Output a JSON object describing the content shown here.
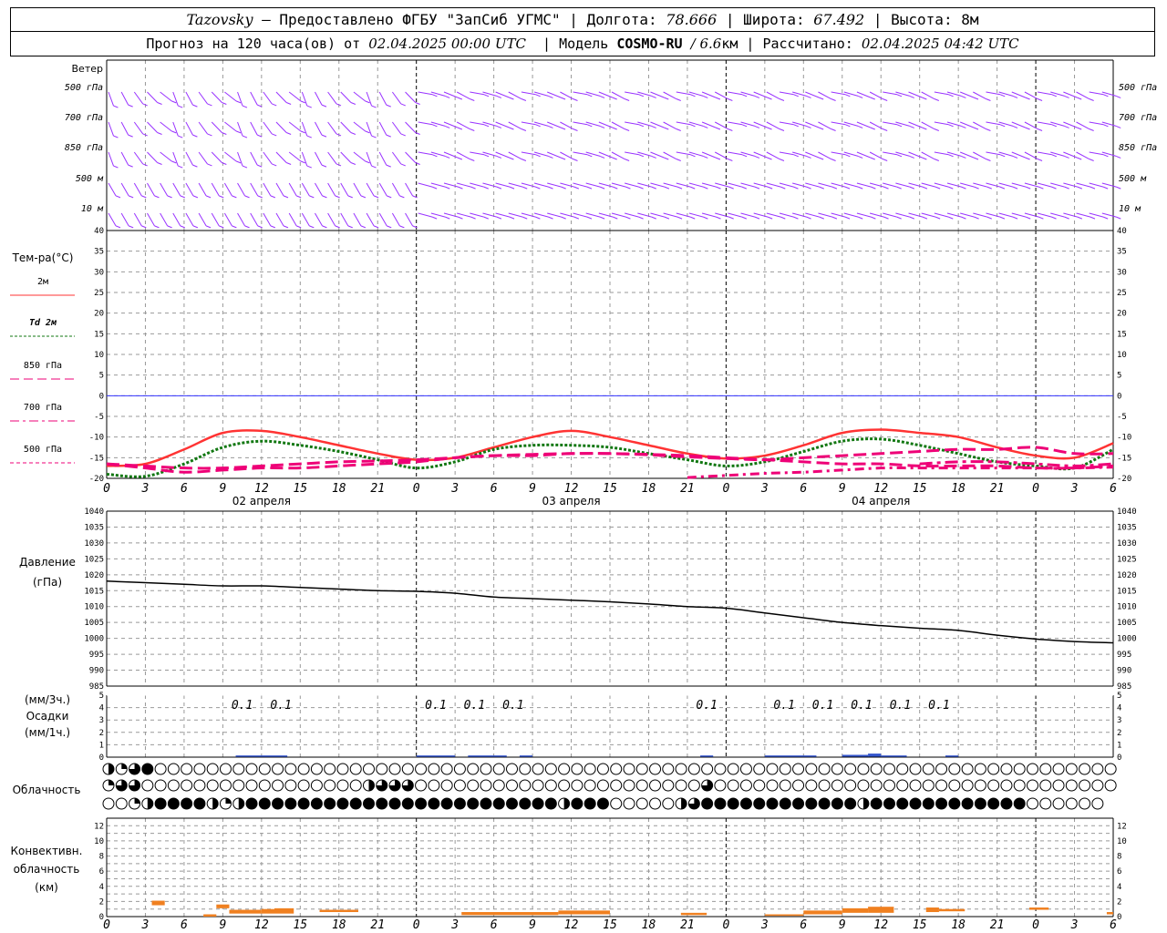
{
  "header": {
    "station": "Tazovsky",
    "provided_by": "— Предоставлено ФГБУ \"ЗапСиб УГМС\"",
    "lon_label": "Долгота:",
    "lon_value": "78.666",
    "lat_label": "Широта:",
    "lat_value": "67.492",
    "alt_label": "Высота:",
    "alt_value": "8м",
    "forecast_label": "Прогноз на 120 часа(ов) от",
    "forecast_start": "02.04.2025 00:00 UTC",
    "model_label": "Модель",
    "model_name": "COSMO-RU",
    "model_res": "/ 6.6",
    "model_res_unit": "км",
    "calc_label": "Рассчитано:",
    "calc_time": "02.04.2025 04:42 UTC"
  },
  "colors": {
    "wind": "#9933ff",
    "t2m": "#ff3333",
    "td2m": "#117711",
    "t850": "#ee0077",
    "t700": "#ee0077",
    "t500": "#ee0077",
    "zero_line": "#3333ff",
    "pressure": "#000000",
    "precip": "#3355cc",
    "convective": "#f08020",
    "grid": "#999999"
  },
  "chart_data": [
    {
      "type": "wind_barbs",
      "panel_title": "Ветер",
      "levels": [
        "500 гПа",
        "700 гПа",
        "850 гПа",
        "500 м",
        "10 м"
      ]
    },
    {
      "type": "line",
      "panel_title": "Тем-ра(°C)",
      "x_tick_labels": [
        "0",
        "3",
        "6",
        "9",
        "12",
        "15",
        "18",
        "21",
        "0",
        "3",
        "6",
        "9",
        "12",
        "15",
        "18",
        "21",
        "0",
        "3",
        "6",
        "9",
        "12",
        "15",
        "18",
        "21",
        "0",
        "3",
        "6"
      ],
      "day_labels": [
        "02 апреля",
        "03 апреля",
        "04 апреля"
      ],
      "x_hours_range": [
        0,
        78
      ],
      "ylim": [
        -20,
        40
      ],
      "y_ticks": [
        -20,
        -15,
        -10,
        -5,
        0,
        5,
        10,
        15,
        20,
        25,
        30,
        35,
        40
      ],
      "legend": [
        {
          "id": "t2m",
          "label": "2м"
        },
        {
          "id": "td2m",
          "label_prefix": "Td",
          "label": "2м"
        },
        {
          "id": "t850",
          "label": "850 гПа"
        },
        {
          "id": "t700",
          "label": "700 гПа"
        },
        {
          "id": "t500",
          "label": "500 гПа"
        }
      ],
      "series": [
        {
          "name": "2м",
          "x": [
            0,
            3,
            6,
            9,
            12,
            15,
            18,
            21,
            24,
            27,
            30,
            33,
            36,
            39,
            42,
            45,
            48,
            51,
            54,
            57,
            60,
            63,
            66,
            69,
            72,
            75,
            78
          ],
          "values": [
            -17,
            -16.5,
            -13,
            -9,
            -8.5,
            -10,
            -12,
            -14,
            -15.5,
            -15,
            -12.5,
            -10,
            -8.5,
            -10,
            -12,
            -14,
            -15.2,
            -14.5,
            -12,
            -9,
            -8.2,
            -9,
            -10,
            -12.5,
            -14.5,
            -15,
            -11.5
          ]
        },
        {
          "name": "Td 2м",
          "x": [
            0,
            3,
            6,
            9,
            12,
            15,
            18,
            21,
            24,
            27,
            30,
            33,
            36,
            39,
            42,
            45,
            48,
            51,
            54,
            57,
            60,
            63,
            66,
            69,
            72,
            75,
            78
          ],
          "values": [
            -19,
            -19.5,
            -16.5,
            -12.5,
            -11,
            -12,
            -13.5,
            -15.5,
            -17.5,
            -16,
            -13,
            -12,
            -12,
            -12.5,
            -14,
            -15.5,
            -17,
            -16,
            -13.5,
            -11,
            -10.5,
            -12,
            -14,
            -16,
            -17,
            -17.5,
            -13
          ]
        },
        {
          "name": "850 гПа",
          "x": [
            0,
            3,
            6,
            9,
            12,
            15,
            18,
            21,
            24,
            27,
            30,
            33,
            36,
            39,
            42,
            45,
            48,
            51,
            54,
            57,
            60,
            63,
            66,
            69,
            72,
            75,
            78
          ],
          "values": [
            -16.5,
            -17,
            -17.5,
            -17.5,
            -17,
            -16.5,
            -16,
            -15.8,
            -15.5,
            -15,
            -14.5,
            -14.2,
            -14,
            -14,
            -14.3,
            -14.8,
            -15.2,
            -15.5,
            -15,
            -14.5,
            -14,
            -13.5,
            -13,
            -13,
            -12.5,
            -14,
            -14
          ]
        },
        {
          "name": "700 гПа",
          "x": [
            63,
            66,
            69,
            72,
            75,
            78
          ],
          "values": [
            -16.5,
            -16,
            -16,
            -16.5,
            -17,
            -16.5
          ]
        },
        {
          "name": "500 гПа",
          "x": [
            0,
            3,
            6,
            9,
            12,
            15,
            18,
            21,
            24,
            27,
            30,
            33,
            36,
            39,
            42,
            45,
            48,
            51,
            54,
            57,
            60,
            63,
            66,
            69,
            72,
            75,
            78
          ],
          "values": [
            -16.5,
            -17.5,
            -18.5,
            -18,
            -17.5,
            -17.5,
            -17,
            -16.5,
            -16,
            -15,
            -14.5,
            -14.5,
            -14,
            -14,
            -14.2,
            -14.5,
            -15,
            -15.5,
            -16,
            -16.5,
            -16.5,
            -17,
            -17,
            -17,
            -17.5,
            -17.5,
            -17
          ]
        },
        {
          "name": "500 гПа dash-dot",
          "x": [
            45,
            48,
            51,
            54,
            57,
            60,
            63,
            66,
            69,
            72,
            75,
            78
          ],
          "values": [
            -19.8,
            -19.3,
            -18.8,
            -18.5,
            -18,
            -17.5,
            -17.5,
            -17.5,
            -17.5,
            -17.5,
            -17.5,
            -17.3
          ]
        }
      ]
    },
    {
      "type": "line",
      "panel_title": "Давление",
      "panel_unit": "(гПа)",
      "ylim": [
        985,
        1040
      ],
      "y_ticks": [
        985,
        990,
        995,
        1000,
        1005,
        1010,
        1015,
        1020,
        1025,
        1030,
        1035,
        1040
      ],
      "series": [
        {
          "name": "Давление",
          "x": [
            0,
            3,
            6,
            9,
            12,
            15,
            18,
            21,
            24,
            27,
            30,
            33,
            36,
            39,
            42,
            45,
            48,
            51,
            54,
            57,
            60,
            63,
            66,
            69,
            72,
            75,
            78
          ],
          "values": [
            1018,
            1017.5,
            1017,
            1016.5,
            1016.5,
            1016,
            1015.5,
            1015,
            1014.8,
            1014.2,
            1013,
            1012.5,
            1012,
            1011.5,
            1010.8,
            1010,
            1009.5,
            1008,
            1006.5,
            1005,
            1004,
            1003.2,
            1002.5,
            1001,
            999.8,
            999,
            998.6
          ]
        }
      ]
    },
    {
      "type": "bar",
      "panel_title": "Осадки",
      "units_3h": "(мм/3ч.)",
      "units_1h": "(мм/1ч.)",
      "ylim": [
        0,
        5
      ],
      "y_ticks": [
        0,
        1,
        2,
        3,
        4,
        5
      ],
      "labels": [
        {
          "x": 10.5,
          "text": "0.1"
        },
        {
          "x": 13.5,
          "text": "0.1"
        },
        {
          "x": 25.5,
          "text": "0.1"
        },
        {
          "x": 28.5,
          "text": "0.1"
        },
        {
          "x": 31.5,
          "text": "0.1"
        },
        {
          "x": 46.5,
          "text": "0.1"
        },
        {
          "x": 52.5,
          "text": "0.1"
        },
        {
          "x": 55.5,
          "text": "0.1"
        },
        {
          "x": 58.5,
          "text": "0.1"
        },
        {
          "x": 61.5,
          "text": "0.1"
        },
        {
          "x": 64.5,
          "text": "0.1"
        }
      ],
      "hourly_values": [
        {
          "x0": 10,
          "x1": 14,
          "value": 0.1
        },
        {
          "x0": 24,
          "x1": 27,
          "value": 0.1
        },
        {
          "x0": 28,
          "x1": 31,
          "value": 0.1
        },
        {
          "x0": 32,
          "x1": 33,
          "value": 0.1
        },
        {
          "x0": 46,
          "x1": 47,
          "value": 0.1
        },
        {
          "x0": 51,
          "x1": 55,
          "value": 0.1
        },
        {
          "x0": 57,
          "x1": 59,
          "value": 0.15
        },
        {
          "x0": 59,
          "x1": 60,
          "value": 0.25
        },
        {
          "x0": 60,
          "x1": 62,
          "value": 0.1
        },
        {
          "x0": 65,
          "x1": 66,
          "value": 0.1
        }
      ]
    },
    {
      "type": "cloud_cover",
      "panel_title": "Облачность",
      "rows": [
        "HQTFOOOOOOOOOOOOOOOOOOOOOOOOOOOOOOOOOOOOOOOOOOOOOOOOOOOOOOOOOOOOOOOOOOOOOOOOOO",
        "QTTOOOOOOOOOOOOOOOOOHTTTOOOOOOOOOOOOOOOOOOOOOOTOOOOOOOOOOOOOOOOOOOOOOOOOOOOOOOOO",
        "OOQHFFFFHQHFFFFFFFFFFFFFFFFFFFFFFFFHFFFOOOOOHTFFFFFFFFFFFFHFFFFFFFFFFFFOOOOOO"
      ]
    },
    {
      "type": "bar",
      "panel_title": "Конвективн. облачность (км)",
      "ylim": [
        0,
        13
      ],
      "y_ticks": [
        0,
        2,
        4,
        6,
        8,
        10,
        12
      ],
      "bars": [
        {
          "x0": 3.5,
          "x1": 4.5,
          "base": 1.5,
          "top": 2.1
        },
        {
          "x0": 7.5,
          "x1": 8.5,
          "base": 0,
          "top": 0.3
        },
        {
          "x0": 8.5,
          "x1": 9.5,
          "base": 1.1,
          "top": 1.6
        },
        {
          "x0": 9.5,
          "x1": 12,
          "base": 0.4,
          "top": 0.9
        },
        {
          "x0": 12,
          "x1": 13,
          "base": 0.4,
          "top": 1.0
        },
        {
          "x0": 13,
          "x1": 14.5,
          "base": 0.4,
          "top": 1.1
        },
        {
          "x0": 16.5,
          "x1": 19.5,
          "base": 0.6,
          "top": 0.9
        },
        {
          "x0": 27.5,
          "x1": 35,
          "base": 0.2,
          "top": 0.6
        },
        {
          "x0": 35,
          "x1": 39,
          "base": 0.3,
          "top": 0.8
        },
        {
          "x0": 44.5,
          "x1": 46.5,
          "base": 0.2,
          "top": 0.5
        },
        {
          "x0": 51,
          "x1": 54,
          "base": 0.1,
          "top": 0.3
        },
        {
          "x0": 54,
          "x1": 57,
          "base": 0.3,
          "top": 0.8
        },
        {
          "x0": 57,
          "x1": 59,
          "base": 0.5,
          "top": 1.1
        },
        {
          "x0": 59,
          "x1": 61,
          "base": 0.5,
          "top": 1.3
        },
        {
          "x0": 63.5,
          "x1": 64.5,
          "base": 0.6,
          "top": 1.2
        },
        {
          "x0": 64.5,
          "x1": 66.5,
          "base": 0.7,
          "top": 1.0
        },
        {
          "x0": 71.5,
          "x1": 73,
          "base": 0.9,
          "top": 1.2
        },
        {
          "x0": 77.5,
          "x1": 78,
          "base": 0.3,
          "top": 0.6
        }
      ]
    }
  ]
}
